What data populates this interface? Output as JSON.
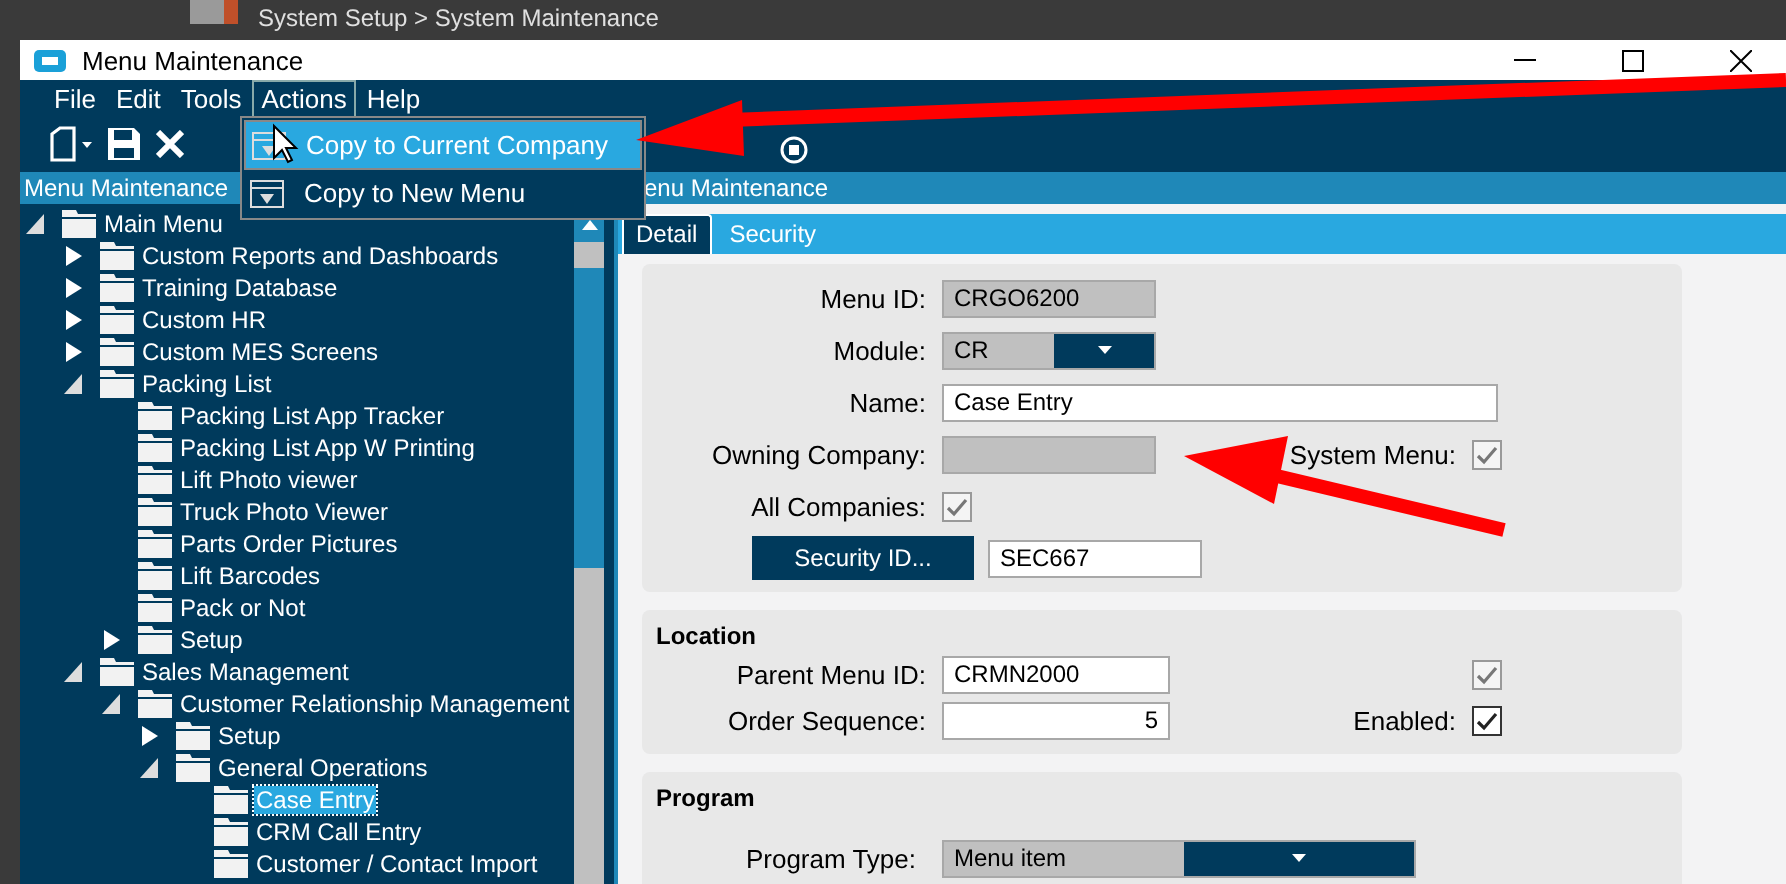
{
  "background": {
    "breadcrumb": "System Setup > System Maintenance"
  },
  "window": {
    "title": "Menu Maintenance"
  },
  "menubar": [
    {
      "label": "File",
      "selected": false
    },
    {
      "label": "Edit",
      "selected": false
    },
    {
      "label": "Tools",
      "selected": false
    },
    {
      "label": "Actions",
      "selected": true
    },
    {
      "label": "Help",
      "selected": false
    }
  ],
  "actions_menu": [
    {
      "label": "Copy to Current Company",
      "selected": true
    },
    {
      "label": "Copy to New Menu",
      "selected": false
    }
  ],
  "tree_panel": {
    "title": "Menu Maintenance",
    "tree": [
      {
        "label": "Main Menu",
        "expanded": true,
        "selected": false,
        "children": [
          {
            "label": "Custom Reports and Dashboards",
            "expanded": false,
            "selected": false
          },
          {
            "label": "Training Database",
            "expanded": false,
            "selected": false
          },
          {
            "label": "Custom HR",
            "expanded": false,
            "selected": false
          },
          {
            "label": "Custom MES Screens",
            "expanded": false,
            "selected": false
          },
          {
            "label": "Packing List",
            "expanded": true,
            "selected": false,
            "children": [
              {
                "label": "Packing List App Tracker",
                "selected": false
              },
              {
                "label": "Packing List App W Printing",
                "selected": false
              },
              {
                "label": "Lift Photo viewer",
                "selected": false
              },
              {
                "label": "Truck Photo Viewer",
                "selected": false
              },
              {
                "label": "Parts Order Pictures",
                "selected": false
              },
              {
                "label": "Lift Barcodes",
                "selected": false
              },
              {
                "label": "Pack or Not",
                "selected": false
              },
              {
                "label": "Setup",
                "expanded": false,
                "selected": false
              }
            ]
          },
          {
            "label": "Sales Management",
            "expanded": true,
            "selected": false,
            "children": [
              {
                "label": "Customer Relationship Management",
                "expanded": true,
                "selected": false,
                "children": [
                  {
                    "label": "Setup",
                    "expanded": false,
                    "selected": false
                  },
                  {
                    "label": "General Operations",
                    "expanded": true,
                    "selected": false,
                    "children": [
                      {
                        "label": "Case Entry",
                        "selected": true
                      },
                      {
                        "label": "CRM Call Entry",
                        "selected": false
                      },
                      {
                        "label": "Customer / Contact Import",
                        "selected": false
                      }
                    ]
                  }
                ]
              }
            ]
          }
        ]
      }
    ]
  },
  "detail_panel": {
    "title": "enu Maintenance",
    "tabs": [
      {
        "label": "Detail",
        "selected": true
      },
      {
        "label": "Security",
        "selected": false
      }
    ],
    "general": {
      "menu_id": {
        "label": "Menu ID:",
        "value": "CRGO6200"
      },
      "module": {
        "label": "Module:",
        "value": "CR"
      },
      "name": {
        "label": "Name:",
        "value": "Case Entry"
      },
      "owning_company": {
        "label": "Owning Company:"
      },
      "system_menu": {
        "label": "System Menu:",
        "checked": true,
        "disabled": true
      },
      "all_companies": {
        "label": "All Companies:",
        "checked": true,
        "disabled": true
      },
      "security_id": {
        "button": "Security ID...",
        "value": "SEC667"
      }
    },
    "location": {
      "title": "Location",
      "parent_menu_id": {
        "label": "Parent Menu ID:",
        "value": "CRMN2000"
      },
      "unlabeled_check": {
        "checked": true,
        "disabled": true
      },
      "order_sequence": {
        "label": "Order Sequence:",
        "value": "5"
      },
      "enabled": {
        "label": "Enabled:",
        "checked": true,
        "disabled": false
      }
    },
    "program": {
      "title": "Program",
      "program_type": {
        "label": "Program Type:",
        "value": "Menu item"
      }
    }
  }
}
